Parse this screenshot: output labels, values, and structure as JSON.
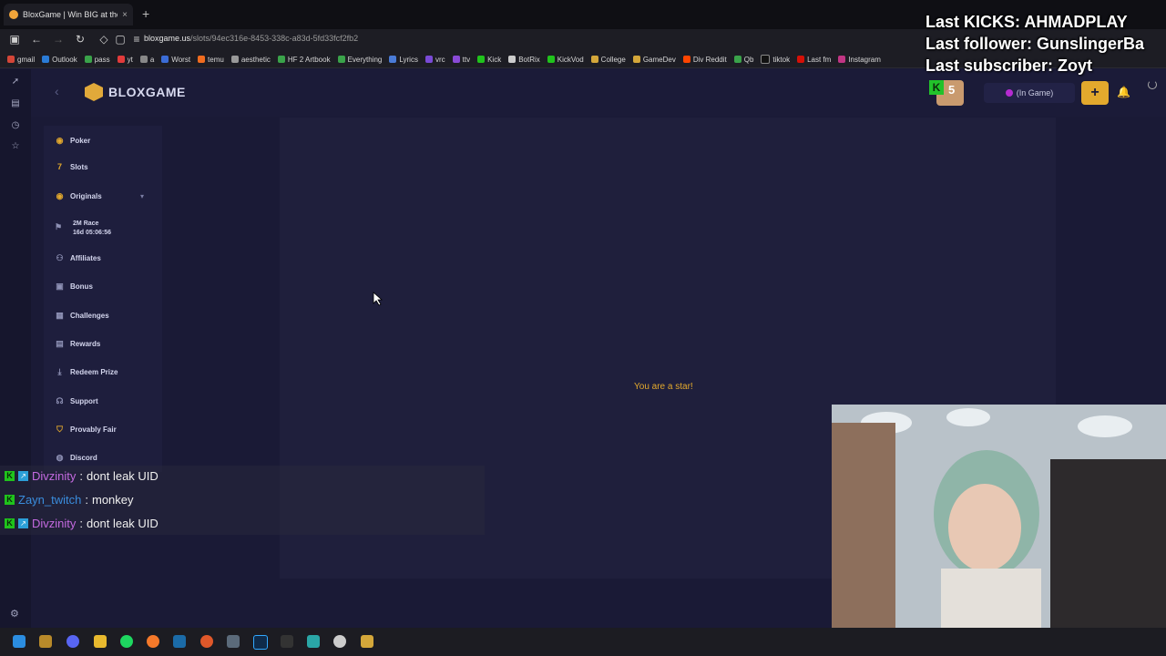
{
  "browser": {
    "tab_title": "BloxGame | Win BIG at the",
    "tab_close": "×",
    "new_tab": "+",
    "url_host": "bloxgame.us",
    "url_path": "/slots/94ec316e-8453-338c-a83d-5fd33fcf2fb2",
    "bookmarks": [
      "gmail",
      "Outlook",
      "pass",
      "yt",
      "a",
      "Worst",
      "temu",
      "aesthetic",
      "HF 2 Artbook",
      "Everything",
      "Lyrics",
      "vrc",
      "ttv",
      "Kick",
      "BotRix",
      "KickVod",
      "College",
      "GameDev",
      "Div Reddit",
      "Qb",
      "tiktok",
      "Last fm",
      "Instagram"
    ]
  },
  "app": {
    "logo_text": "BLOXGAME",
    "status_label": "(In Game)",
    "avatar_level": "5",
    "avatar_badge": "K",
    "add_label": "+"
  },
  "sidebar": {
    "items": [
      {
        "label": "Poker"
      },
      {
        "label": "Slots"
      },
      {
        "label": "Originals"
      },
      {
        "label": "Affiliates"
      },
      {
        "label": "Bonus"
      },
      {
        "label": "Challenges"
      },
      {
        "label": "Rewards"
      },
      {
        "label": "Redeem Prize"
      },
      {
        "label": "Support"
      },
      {
        "label": "Provably Fair"
      },
      {
        "label": "Discord"
      }
    ],
    "race": {
      "amount": "2M",
      "label": "Race",
      "timer": "16d 05:06:56"
    }
  },
  "main": {
    "message": "You are a star!"
  },
  "chat": [
    {
      "user": "Divzinity",
      "sep": " : ",
      "text": "dont leak UID"
    },
    {
      "user": "Zayn_twitch",
      "sep": " : ",
      "text": "monkey"
    },
    {
      "user": "Divzinity",
      "sep": " : ",
      "text": "dont leak UID"
    }
  ],
  "stream_overlay": {
    "kicks": "Last KICKS: AHMADPLAY",
    "follower": "Last follower: GunslingerBa",
    "subscriber": "Last subscriber: Zoyt"
  },
  "colors": {
    "accent": "#e3a92d",
    "background": "#1a1a36",
    "panel": "#1f1f3c"
  }
}
